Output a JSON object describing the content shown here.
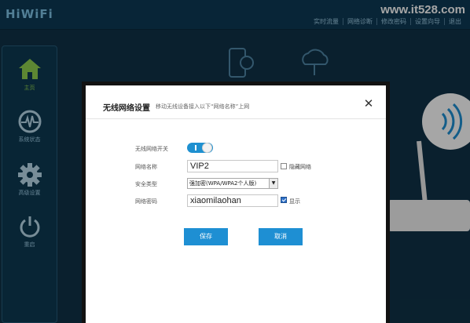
{
  "app": {
    "logo": "HiWiFi",
    "watermark": "www.it528.com",
    "nav": [
      "实时流量",
      "网络诊断",
      "修改密码",
      "设置向导",
      "退出"
    ]
  },
  "sidebar": {
    "items": [
      {
        "label": "主页",
        "icon": "home-icon",
        "active": true
      },
      {
        "label": "系统状态",
        "icon": "pulse-icon",
        "active": false
      },
      {
        "label": "高级设置",
        "icon": "gear-icon",
        "active": false
      },
      {
        "label": "重启",
        "icon": "power-icon",
        "active": false
      }
    ]
  },
  "dialog": {
    "title": "无线网络设置",
    "subtitle": "移动无线设备接入以下“网络名称”上网",
    "close_label": "✕",
    "wifi_switch_label": "无线网络开关",
    "wifi_switch_on": true,
    "ssid_label": "网络名称",
    "ssid_value": "VIP2",
    "hide_network_label": "隐藏网络",
    "hide_network_checked": false,
    "security_label": "安全类型",
    "security_value": "强加密(WPA/WPA2个人版)",
    "password_label": "网络密码",
    "password_value": "xiaomilaohan",
    "show_password_label": "显示",
    "show_password_checked": true,
    "save_label": "保存",
    "cancel_label": "取消"
  },
  "colors": {
    "accent": "#1e8fd3",
    "active_green": "#8fd04f",
    "header_bg": "#0d3a55"
  }
}
